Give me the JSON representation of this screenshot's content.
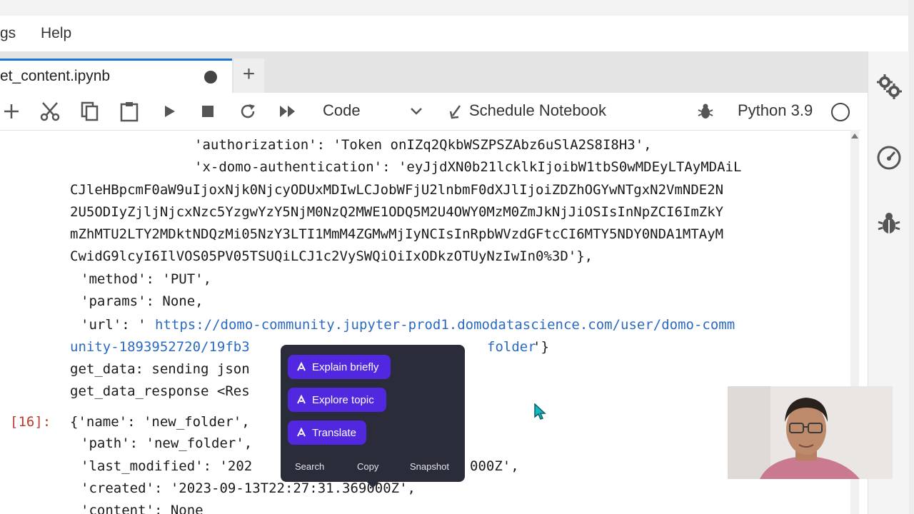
{
  "menu": {
    "items": [
      "gs",
      "Help"
    ]
  },
  "tab": {
    "title": "et_content.ipynb",
    "new_tab_label": "+"
  },
  "toolbar": {
    "cell_type": "Code",
    "schedule_label": "Schedule Notebook",
    "kernel_name": "Python 3.9"
  },
  "output": {
    "lines": [
      "'authorization': 'Token onIZq2QkbWSZPSZAbz6uSlA2S8I8H3',",
      "'x-domo-authentication': 'eyJjdXN0b21lcklkIjoibW1tbS0wMDEyLTAyMDAiL",
      "CJleHBpcmF0aW9uIjoxNjk0NjcyODUxMDIwLCJobWFjU2lnbmF0dXJlIjoiZDZhOGYwNTgxN2VmNDE2N",
      "2U5ODIyZjljNjcxNzc5YzgwYzY5NjM0NzQ2MWE1ODQ5M2U4OWY0MzM0ZmJkNjJiOSIsInNpZCI6ImZkY",
      "mZhMTU2LTY2MDktNDQzMi05NzY3LTI1MmM4ZGMwMjIyNCIsInRpbWVzdGFtcCI6MTY5NDY0NDA1MTAyM",
      "CwidG9lcyI6IlVOS05PV05TSUQiLCJ1c2VySWQiOiIxODkzOTUyNzIwIn0%3D'},",
      "'method': 'PUT',",
      "'params': None,",
      "'url': '",
      "https://domo-community.jupyter-prod1.domodatascience.com/user/domo-comm",
      "unity-1893952720/19fb3",
      "folder",
      "'}",
      "get_data: sending json",
      "get_data_response <Res",
      "{'name': 'new_folder',",
      "'path': 'new_folder',",
      "'last_modified': '202",
      "000Z',",
      "'created': '2023-09-13T22:27:31.369000Z',",
      "'content': None"
    ],
    "prompt": "[16]:"
  },
  "popup": {
    "actions": [
      "Explain briefly",
      "Explore topic",
      "Translate"
    ],
    "footer": [
      "Search",
      "Copy",
      "Snapshot"
    ]
  },
  "colors": {
    "accent": "#1976d2",
    "pill": "#5128e0",
    "popup_bg": "#2a2c3a",
    "url": "#2a6ac1",
    "prompt": "#c0392b"
  }
}
